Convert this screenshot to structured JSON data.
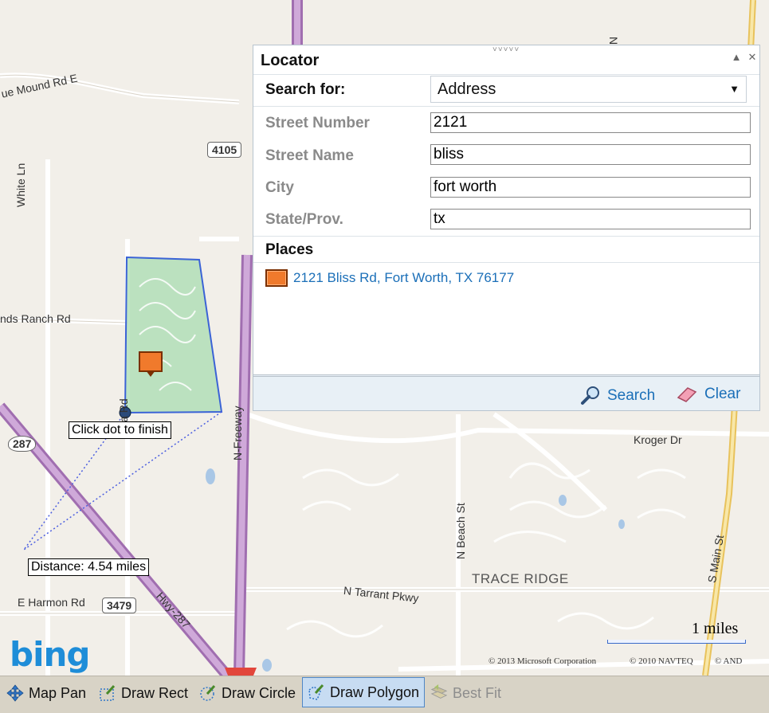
{
  "map": {
    "labels": {
      "mound_rd": "ue Mound Rd E",
      "white_ln": "White Ln",
      "ranch_rd": "nds Ranch Rd",
      "haslet_rd": "Ha   Rd",
      "n_freeway": "N-Freeway",
      "hwy287": "Hwy-287",
      "e_harmon": "E Harmon Rd",
      "kroger": "Kroger Dr",
      "n_beach": "N Beach St",
      "trace_ridge": "TRACE RIDGE",
      "n_tarrant": "N Tarrant Pkwy",
      "s_main": "S Main St",
      "n_top": "N"
    },
    "shields": {
      "s4105": "4105",
      "s287": "287",
      "s3479": "3479"
    },
    "notes": {
      "finish": "Click dot to finish",
      "distance": "Distance: 4.54 miles"
    },
    "logo": "bing",
    "scale": "1 miles",
    "copyright": [
      "© 2013 Microsoft Corporation",
      "© 2010 NAVTEQ",
      "© AND"
    ]
  },
  "locator": {
    "title": "Locator",
    "search_for_label": "Search for:",
    "search_for_value": "Address",
    "fields": [
      {
        "label": "Street Number",
        "value": "2121"
      },
      {
        "label": "Street Name",
        "value": "bliss"
      },
      {
        "label": "City",
        "value": "fort worth"
      },
      {
        "label": "State/Prov.",
        "value": "tx"
      }
    ],
    "places_title": "Places",
    "place": "2121 Bliss Rd, Fort Worth, TX 76177",
    "search_btn": "Search",
    "clear_btn": "Clear"
  },
  "toolbar": {
    "map_pan": "Map Pan",
    "draw_rect": "Draw Rect",
    "draw_circle": "Draw Circle",
    "draw_polygon": "Draw Polygon",
    "best_fit": "Best Fit"
  },
  "colors": {
    "polygon_fill": "#a8dcb0",
    "polygon_stroke": "#3b63d6",
    "highway": "#b98fc7",
    "link": "#1b6fb8"
  }
}
